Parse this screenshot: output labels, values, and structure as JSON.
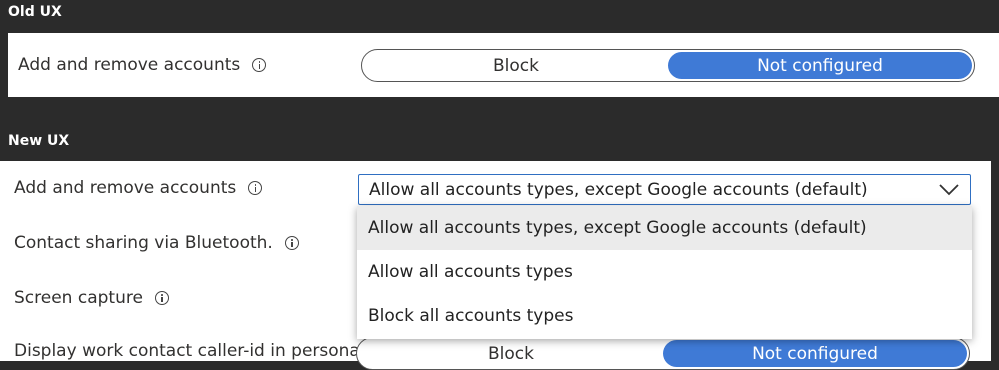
{
  "old_ux": {
    "heading": "Old UX",
    "setting_label": "Add and remove accounts",
    "toggle": {
      "options": [
        "Block",
        "Not configured"
      ],
      "selected": "Not configured"
    }
  },
  "new_ux": {
    "heading": "New UX",
    "settings": [
      {
        "label": "Add and remove accounts"
      },
      {
        "label": "Contact sharing via Bluetooth."
      },
      {
        "label": "Screen capture"
      },
      {
        "label": "Display work contact caller-id in personal"
      }
    ],
    "dropdown": {
      "value": "Allow all accounts types, except Google accounts (default)",
      "options": [
        "Allow all accounts types, except Google accounts (default)",
        "Allow all accounts types",
        "Block all accounts types"
      ],
      "highlighted_index": 0
    },
    "partial_toggle": {
      "options": [
        "Block",
        "Not configured"
      ],
      "selected": "Not configured"
    }
  },
  "icons": {
    "info": "info-icon",
    "chevron": "chevron-down-icon"
  },
  "colors": {
    "accent": "#3f7ad6",
    "background": "#2b2b2b",
    "dropdown_border": "#2f6fc2"
  }
}
